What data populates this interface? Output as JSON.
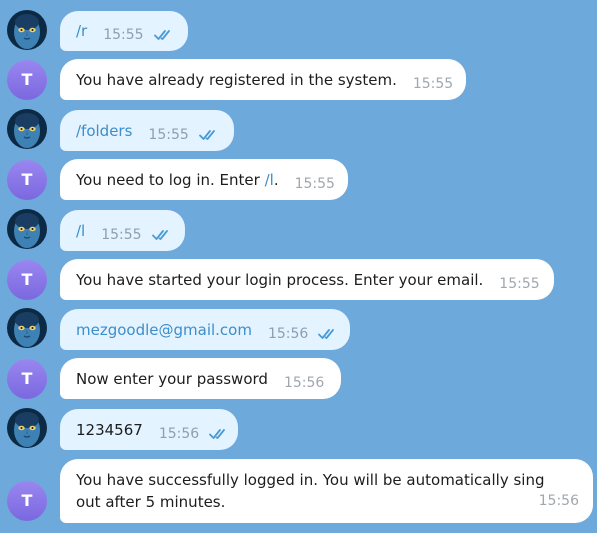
{
  "colors": {
    "background": "#6ea9db",
    "outgoing_bubble": "#e3f3ff",
    "incoming_bubble": "#ffffff",
    "bot_avatar": "#8a77ea",
    "link": "#3d8ec9"
  },
  "bot_avatar_letter": "T",
  "messages": [
    {
      "text": "/r",
      "time": "15:55"
    },
    {
      "text": "You have already registered in the system.",
      "time": "15:55"
    },
    {
      "text": "/folders",
      "time": "15:55"
    },
    {
      "text_prefix": "You need to log in. Enter ",
      "cmd": "/l",
      "text_suffix": ".",
      "time": "15:55"
    },
    {
      "text": "/l",
      "time": "15:55"
    },
    {
      "text": "You have started your login process. Enter your email.",
      "time": "15:55"
    },
    {
      "text": "mezgoodle@gmail.com",
      "time": "15:56"
    },
    {
      "text": "Now enter your password",
      "time": "15:56"
    },
    {
      "text": "1234567",
      "time": "15:56"
    },
    {
      "text": "You have successfully logged in. You will be automatically sing out after 5 minutes.",
      "time": "15:56"
    }
  ]
}
